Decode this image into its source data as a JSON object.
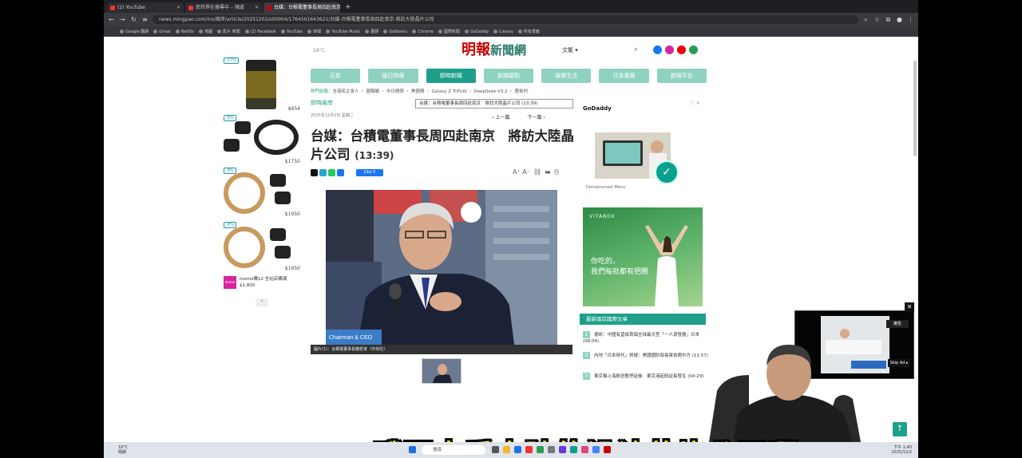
{
  "browser": {
    "tabs": [
      {
        "label": "(2) YouTube",
        "active": false
      },
      {
        "label": "而世界在搜尋中 – 頻道",
        "active": false
      },
      {
        "label": "台媒：台積電董事長周四赴南京",
        "active": true
      },
      {
        "label": "",
        "active": false
      }
    ],
    "new_tab": "+",
    "url": "news.mingpao.com/ins/兩岸/article/20251202/s00004/1764561643621/台媒-台積電董事長周四赴南京-將訪大陸晶片公司",
    "bookmarks": [
      "Google 翻譯",
      "Gmail",
      "Netflix",
      "地圖",
      "影片 新聞",
      "(2) Facebook",
      "YouTube",
      "新聞",
      "YouTube Music",
      "翻譯",
      "Gelbooru",
      "Chrome",
      "國際新聞",
      "GoDaddy",
      "Canary",
      "所有書籤"
    ]
  },
  "site": {
    "logo_main": "明報",
    "logo_sub": "新聞網",
    "lang": "文繁",
    "weather": "18°C",
    "nav": [
      "正新",
      "國日時報",
      "即時新聞",
      "新聞要點",
      "娛樂生活",
      "日本專題",
      "新聞平台"
    ],
    "nav_selected": 2,
    "hot_label": "熱門話題",
    "hot_items": "全港民主會人 ・ 國殤戰 ・ 中日關係 ・ 美國務 ・ Galaxy Z TriFold ・ DeepSeek-V3.2 ・ 藝術村",
    "section": "即時兩岸",
    "dropdown": "台媒：台積電董事長周四赴南京　將訪大陸晶片公司 (13:39)",
    "date": "2025年12月2日 星期二",
    "prev": "上一篇",
    "next": "下一篇"
  },
  "article": {
    "headline": "台媒：台積電董事長周四赴南京　將訪大陸晶片公司",
    "time": "(13:39)",
    "like": "Like 0",
    "font_size": "A⁺ A⁻",
    "caption": "圖片(1)：台積電董事長魏哲家（中央社）",
    "podium_label": "Chairman & CEO"
  },
  "left_ads": [
    {
      "badge": "-17%",
      "price": "$654"
    },
    {
      "badge": "-8%",
      "price": "$1750"
    },
    {
      "badge": "-8%",
      "price": "$1950"
    },
    {
      "badge": "-8%",
      "price": "$1950"
    },
    {
      "badge": "momo",
      "price": "momo購12 全站店購滿$1,800"
    }
  ],
  "right": {
    "gd_brand": "GoDaddy",
    "gd_caption": "Domainsmart Menu",
    "vita_brand": "VITABOX",
    "vita_copy_1": "你吃的，",
    "vita_copy_2": "我們每批都有把關",
    "list_header": "最新兩岸國際文章",
    "list": [
      {
        "n": "1",
        "text": "德研：中國有望成首個全球最大型「一人源發展」日本 (06:04)"
      },
      {
        "n": "2",
        "text": "內地「日本時代」熱搜：美國國防部長將會晤中方 (11:57)"
      },
      {
        "n": "3",
        "text": "東京稱上海航班暫停延後　東京港起航延長發生 (04:29)"
      }
    ]
  },
  "overlay": {
    "pip_badge": "廣告",
    "skip": "Skip Ad ▸",
    "subtitle": "哦要去看大陆的设计芯片公司啊",
    "to_top": "↑"
  },
  "taskbar": {
    "weather_temp": "18°C",
    "weather_text": "晴朗",
    "search": "搜尋",
    "time": "下午 1:40",
    "date": "2025/12/2"
  },
  "colors": {
    "brand_green": "#1f9f8a",
    "nav_light": "#8fd2c2",
    "logo_red": "#cc0000",
    "subtitle_yellow": "#ffe100"
  }
}
